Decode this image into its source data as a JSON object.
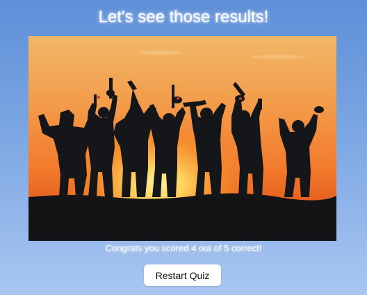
{
  "heading": "Let's see those results!",
  "image": {
    "alt": "Silhouettes of paintball players raising markers in celebration at sunset"
  },
  "result": {
    "score": 4,
    "total": 5,
    "message": "Congrats you scored 4 out of 5 correct!"
  },
  "restart_button": "Restart Quiz",
  "colors": {
    "background_top": "#5f8fd8",
    "background_bottom": "#a9c6f1",
    "sky_top": "#f2b15a",
    "sky_mid": "#f48a35",
    "sun": "#ffd65a",
    "silhouette": "#15161a"
  }
}
